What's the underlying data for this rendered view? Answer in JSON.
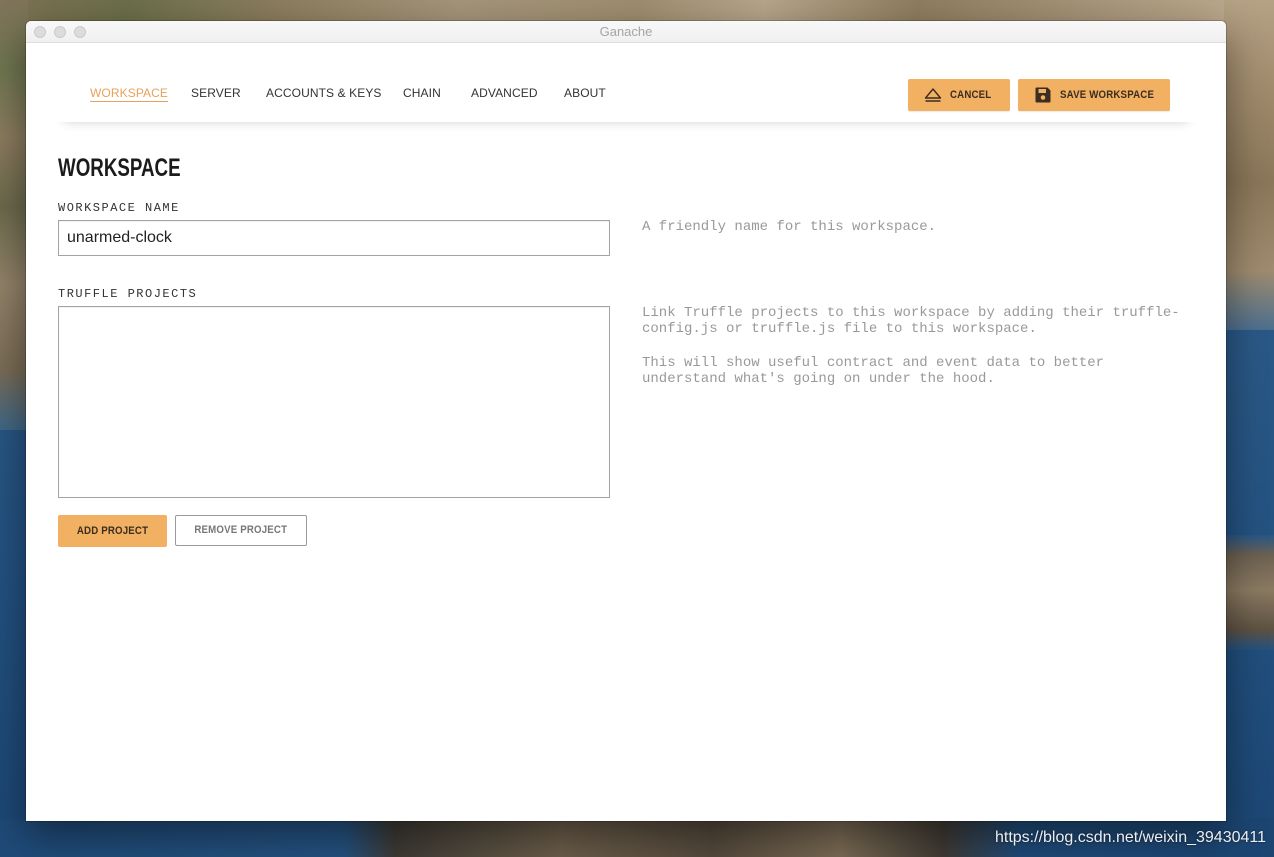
{
  "window": {
    "title": "Ganache"
  },
  "nav": {
    "tabs": [
      {
        "label": "WORKSPACE",
        "active": true
      },
      {
        "label": "SERVER"
      },
      {
        "label": "ACCOUNTS & KEYS"
      },
      {
        "label": "CHAIN"
      },
      {
        "label": "ADVANCED"
      },
      {
        "label": "ABOUT"
      }
    ]
  },
  "actions": {
    "cancel": {
      "label": "CANCEL",
      "icon": "eject-icon"
    },
    "save": {
      "label": "SAVE WORKSPACE",
      "icon": "save-icon"
    }
  },
  "page": {
    "title": "WORKSPACE"
  },
  "workspace_name": {
    "label": "WORKSPACE NAME",
    "value": "unarmed-clock",
    "help": "A friendly name for this workspace."
  },
  "truffle_projects": {
    "label": "TRUFFLE PROJECTS",
    "help": [
      "Link Truffle projects to this workspace by adding their truffle-config.js or truffle.js file to this workspace.",
      "This will show useful contract and event data to better understand what's going on under the hood."
    ],
    "add_label": "ADD PROJECT",
    "remove_label": "REMOVE PROJECT"
  },
  "watermark": "https://blog.csdn.net/weixin_39430411",
  "colors": {
    "accent": "#f2b063",
    "active_tab": "#e6a25a",
    "text": "#333333",
    "muted": "#999999",
    "button_text": "#3b2d1f"
  }
}
